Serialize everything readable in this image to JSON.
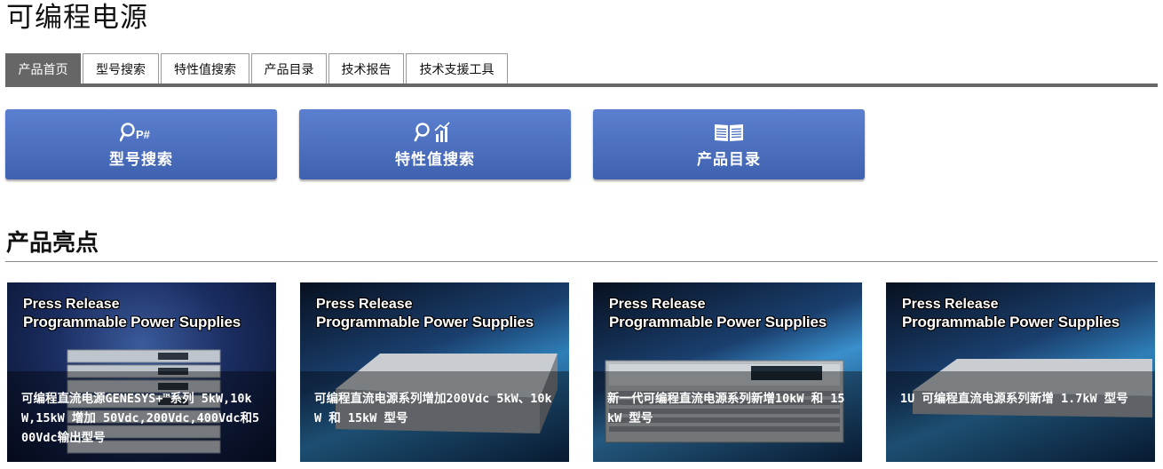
{
  "page": {
    "title": "可编程电源"
  },
  "tabs": [
    {
      "label": "产品首页",
      "active": true
    },
    {
      "label": "型号搜索",
      "active": false
    },
    {
      "label": "特性值搜索",
      "active": false
    },
    {
      "label": "产品目录",
      "active": false
    },
    {
      "label": "技术报告",
      "active": false
    },
    {
      "label": "技术支援工具",
      "active": false
    }
  ],
  "quick_buttons": [
    {
      "label": "型号搜索",
      "icon": "search-part-number-icon"
    },
    {
      "label": "特性值搜索",
      "icon": "search-chart-icon"
    },
    {
      "label": "产品目录",
      "icon": "catalog-book-icon"
    }
  ],
  "highlights": {
    "title": "产品亮点",
    "cards": [
      {
        "press_line1": "Press Release",
        "press_line2": "Programmable Power Supplies",
        "caption": "可编程直流电源GENESYS+™系列 5kW,10kW,15kW 增加 50Vdc,200Vdc,400Vdc和500Vdc输出型号"
      },
      {
        "press_line1": "Press Release",
        "press_line2": "Programmable Power Supplies",
        "caption": "可编程直流电源系列增加200Vdc 5kW、10kW 和 15kW 型号"
      },
      {
        "press_line1": "Press Release",
        "press_line2": "Programmable Power Supplies",
        "caption": "新一代可编程直流电源系列新增10kW 和 15kW 型号"
      },
      {
        "press_line1": "Press Release",
        "press_line2": "Programmable Power Supplies",
        "caption": "1U 可编程直流电源系列新增 1.7kW 型号"
      }
    ]
  },
  "colors": {
    "accent_blue": "#4a6fc0",
    "tab_active": "#666666"
  }
}
